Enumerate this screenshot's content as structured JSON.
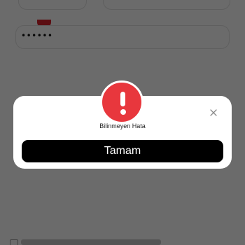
{
  "form": {
    "password_value": "••••••"
  },
  "dialog": {
    "message": "Bilinmeyen Hata",
    "ok_label": "Tamam",
    "alert_icon": "exclamation-icon",
    "close_icon": "close-icon"
  },
  "colors": {
    "alert_red": "#e8373d",
    "button_black": "#000000",
    "overlay": "rgba(0,0,0,0.58)"
  }
}
